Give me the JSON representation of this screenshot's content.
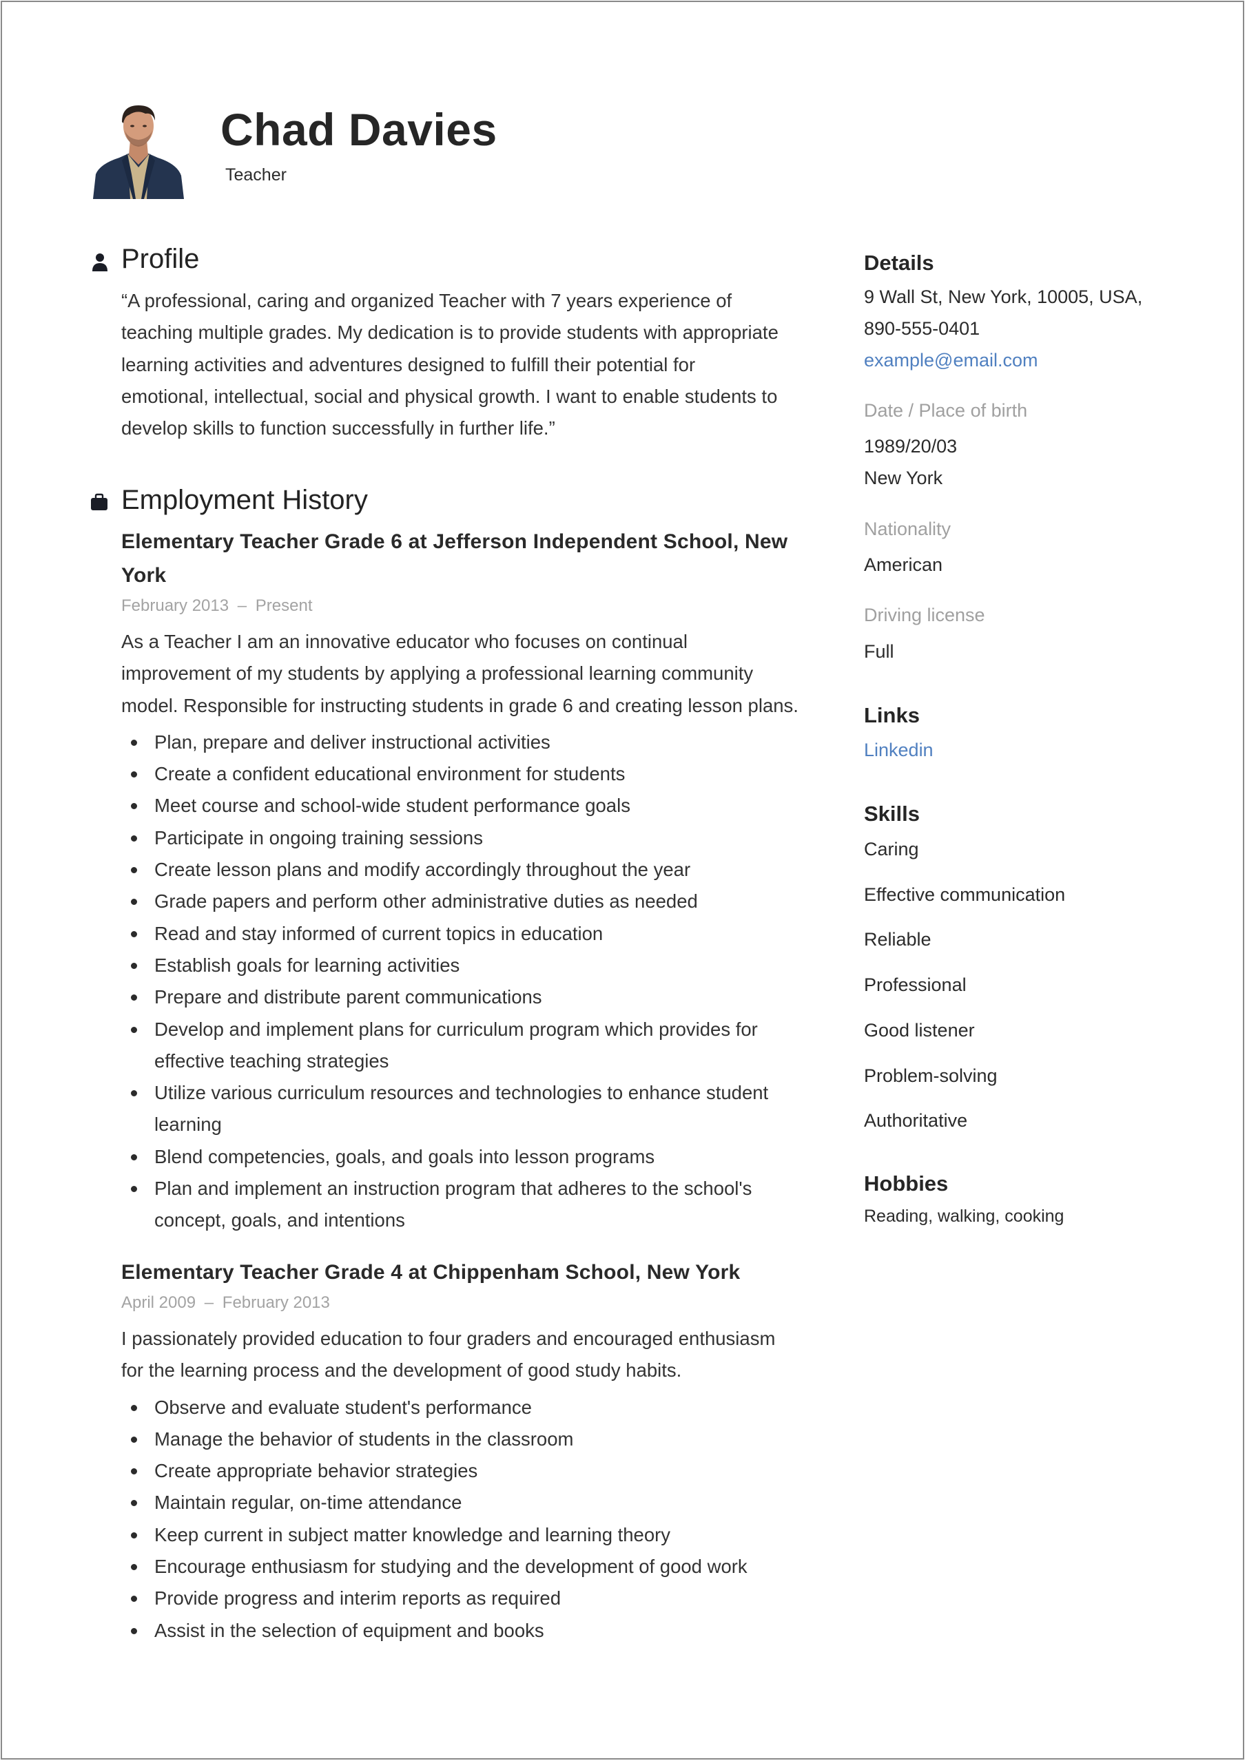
{
  "header": {
    "name": "Chad Davies",
    "title": "Teacher",
    "photo_alt": "Profile photo of Chad Davies"
  },
  "profile": {
    "heading": "Profile",
    "icon": "person-icon",
    "lines": [
      "“A professional, caring and organized Teacher with 7 years experience of",
      "teaching multiple grades. My dedication is to provide students with appropriate",
      "learning activities and adventures designed to fulfill their potential for",
      "emotional, intellectual, social and physical growth. I want to enable students to",
      "develop skills to function successfully in further life.”"
    ]
  },
  "employment": {
    "heading": "Employment History",
    "icon": "briefcase-icon",
    "jobs": [
      {
        "title_lines": [
          "Elementary Teacher Grade 6 at Jefferson Independent School, New",
          "York"
        ],
        "start": "February 2013",
        "separator": "–",
        "end": "Present",
        "description_lines": [
          "As a Teacher I am an innovative educator who focuses on continual",
          "improvement of my students by applying a professional learning community",
          "model. Responsible for instructing students in grade 6 and creating lesson plans."
        ],
        "bullets": [
          [
            "Plan, prepare and deliver instructional activities"
          ],
          [
            "Create a confident educational environment for students"
          ],
          [
            "Meet course and school-wide student performance goals"
          ],
          [
            "Participate in ongoing training sessions"
          ],
          [
            "Create lesson plans and modify accordingly throughout the year"
          ],
          [
            "Grade papers and perform other administrative duties as needed"
          ],
          [
            "Read and stay informed of current topics in education"
          ],
          [
            "Establish goals for learning activities"
          ],
          [
            "Prepare and distribute parent communications"
          ],
          [
            "Develop and implement plans for curriculum program which provides for",
            "effective teaching strategies"
          ],
          [
            "Utilize various curriculum resources and technologies to enhance student",
            "learning"
          ],
          [
            "Blend competencies, goals, and goals into lesson programs"
          ],
          [
            "Plan and implement an instruction program that adheres to the school's",
            "concept, goals, and intentions"
          ]
        ]
      },
      {
        "title_lines": [
          "Elementary Teacher Grade 4 at Chippenham School, New York"
        ],
        "start": "April 2009",
        "separator": "–",
        "end": "February 2013",
        "description_lines": [
          "I passionately provided education to four graders and encouraged enthusiasm",
          "for the learning process and the development of good study habits."
        ],
        "bullets": [
          [
            "Observe and evaluate student's performance"
          ],
          [
            "Manage the behavior of students in the classroom"
          ],
          [
            "Create appropriate behavior strategies"
          ],
          [
            "Maintain regular, on-time attendance"
          ],
          [
            "Keep current in subject matter knowledge and learning theory"
          ],
          [
            "Encourage enthusiasm for studying and the development of good work"
          ],
          [
            "Provide progress and interim reports as required"
          ],
          [
            "Assist in the selection of equipment and books"
          ]
        ]
      }
    ]
  },
  "details": {
    "heading": "Details",
    "address": "9 Wall St, New York, 10005, USA,",
    "phone": "890-555-0401",
    "email": "example@email.com",
    "birth_label": "Date / Place of birth",
    "birth_date": "1989/20/03",
    "birth_place": "New York",
    "nationality_label": "Nationality",
    "nationality": "American",
    "license_label": "Driving license",
    "license": "Full"
  },
  "links": {
    "heading": "Links",
    "items": [
      "Linkedin"
    ]
  },
  "skills": {
    "heading": "Skills",
    "items": [
      "Caring",
      "Effective communication",
      "Reliable",
      "Professional",
      "Good listener",
      "Problem-solving",
      "Authoritative"
    ]
  },
  "hobbies": {
    "heading": "Hobbies",
    "text": "Reading, walking, cooking"
  },
  "colors": {
    "text": "#2b2b2b",
    "muted": "#a0a0a0",
    "link": "#5080c0",
    "border": "#8a8a8a"
  }
}
